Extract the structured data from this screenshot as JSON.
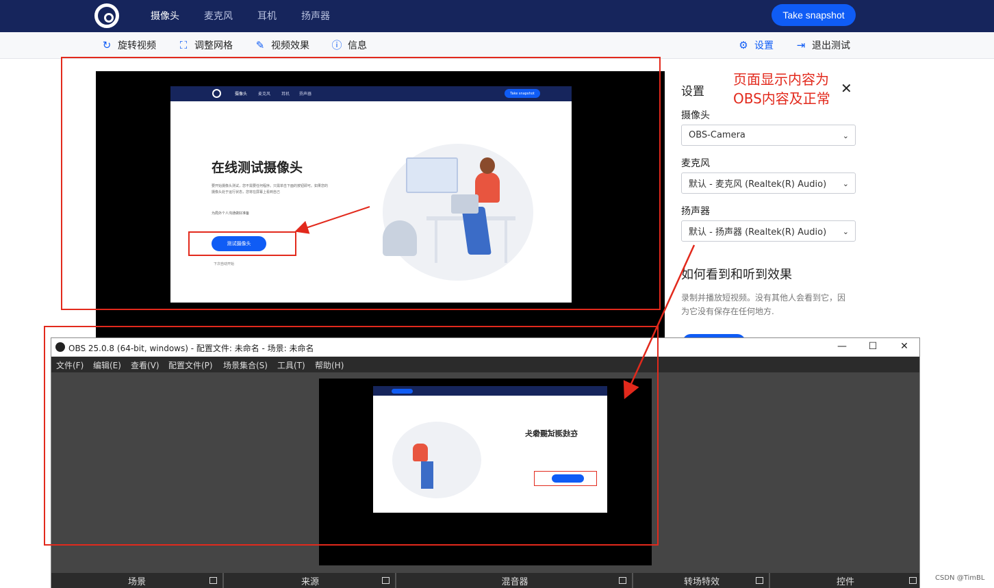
{
  "topnav": {
    "tabs": [
      "摄像头",
      "麦克风",
      "耳机",
      "扬声器"
    ],
    "snapshot_label": "Take snapshot"
  },
  "subbar": {
    "rotate": "旋转视频",
    "grid": "调整网格",
    "effects": "视频效果",
    "info": "信息",
    "settings": "设置",
    "exit": "退出测试"
  },
  "inner_page": {
    "tabs": [
      "摄像头",
      "麦克风",
      "耳机",
      "扬声器"
    ],
    "snapshot_label": "Take snapshot",
    "title": "在线测试摄像头",
    "intro": "要开始摄像头测试，您不需要任何程序。只需单击下面的按钮即可。如果您的摄像头处于运行状态，您将在屏幕上看到自己",
    "subline": "为局外个人沟通做好准备",
    "test_button": "测试摄像头",
    "toggle_label": "下次自动开始"
  },
  "settings": {
    "title": "设置",
    "annotation": "页面显示内容为OBS内容及正常",
    "camera_label": "摄像头",
    "camera_value": "OBS-Camera",
    "mic_label": "麦克风",
    "mic_value": "默认 - 麦克风 (Realtek(R) Audio)",
    "speaker_label": "扬声器",
    "speaker_value": "默认 - 扬声器 (Realtek(R) Audio)",
    "how_title": "如何看到和听到效果",
    "how_text": "录制并播放短视频。没有其他人会看到它，因为它没有保存在任何地方."
  },
  "obs": {
    "title": "OBS 25.0.8 (64-bit, windows) - 配置文件: 未命名 - 场景: 未命名",
    "menus": [
      "文件(F)",
      "编辑(E)",
      "查看(V)",
      "配置文件(P)",
      "场景集合(S)",
      "工具(T)",
      "帮助(H)"
    ],
    "preview_title": "在线测试摄像头",
    "docks": [
      "场景",
      "来源",
      "混音器",
      "转场特效",
      "控件"
    ]
  },
  "watermark": "CSDN @TimBL",
  "colors": {
    "nav": "#16255c",
    "accent": "#0f5cf5",
    "annotation": "#e2291c"
  }
}
